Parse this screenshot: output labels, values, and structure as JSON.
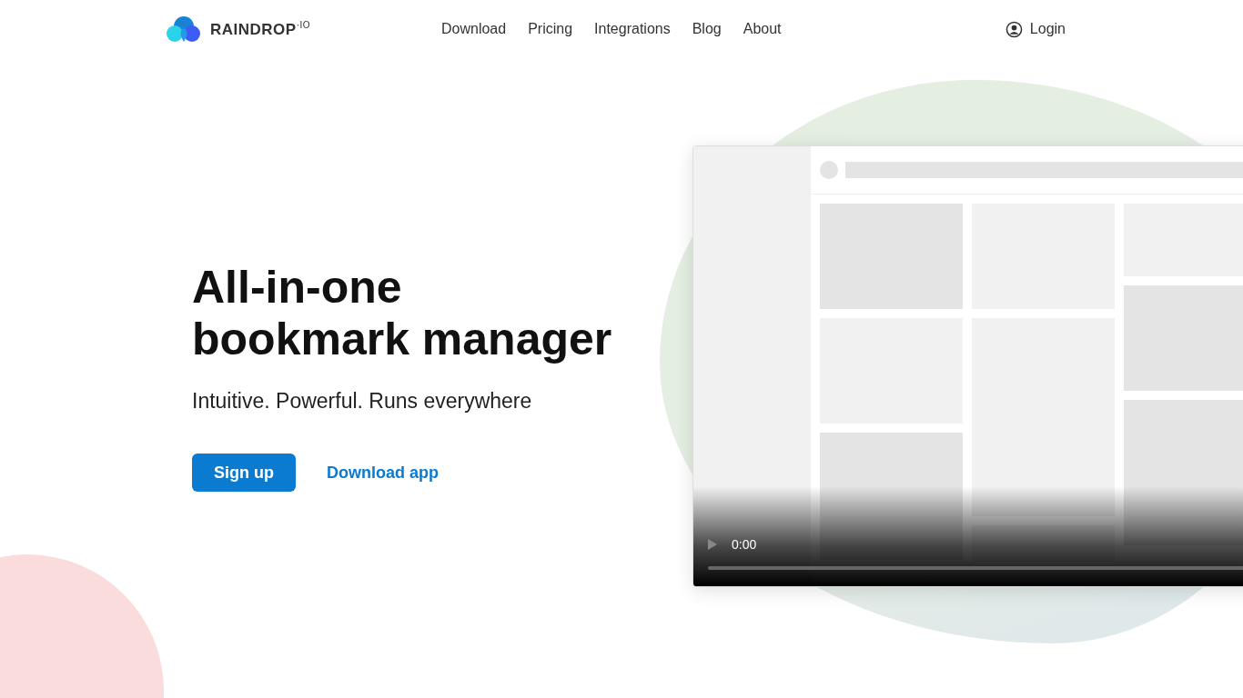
{
  "logo": {
    "text": "RAINDROP$^{·IO}$"
  },
  "nav": [
    {
      "label": "Download"
    },
    {
      "label": "Pricing"
    },
    {
      "label": "Integrations"
    },
    {
      "label": "Blog"
    },
    {
      "label": "About"
    }
  ],
  "login": {
    "label": "Login"
  },
  "hero": {
    "title_lines": [
      "All-in-one",
      "bookmark manager"
    ],
    "subtitle": "Intuitive. Powerful. Runs everywhere",
    "primary_button": "Sign up",
    "secondary_link": "Download app"
  },
  "video": {
    "time": "0:00",
    "level": 0
  }
}
